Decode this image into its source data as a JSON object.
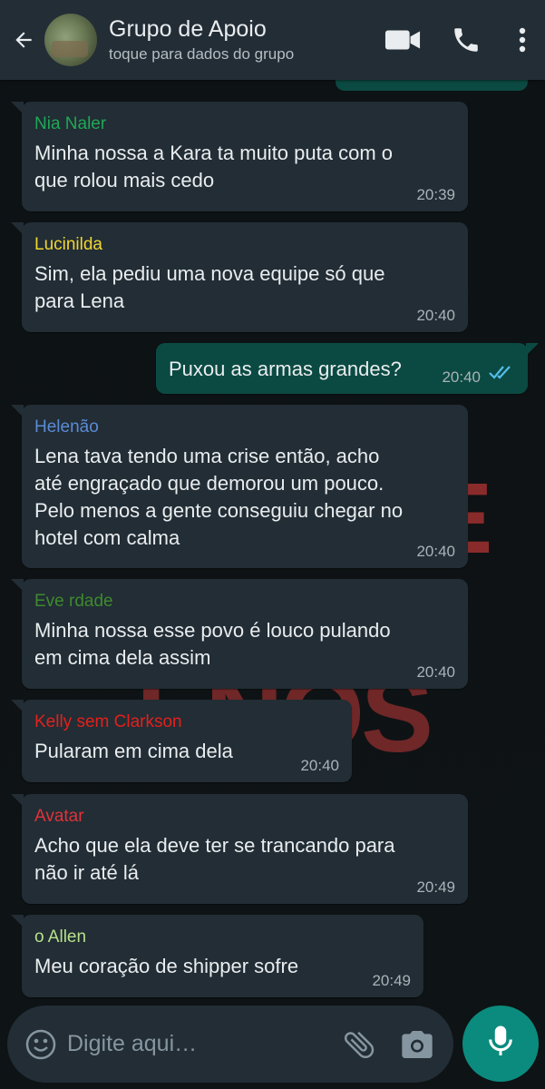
{
  "header": {
    "title": "Grupo de Apoio",
    "subtitle": "toque para dados do grupo"
  },
  "messages": [
    {
      "sender": "Nia Naler",
      "sender_color": "#1fa855",
      "text": "Minha nossa a Kara ta muito puta com o\nque rolou mais cedo",
      "time": "20:39"
    },
    {
      "sender": "Lucinilda",
      "sender_color": "#f1d631",
      "text": "Sim, ela pediu uma nova equipe só que\npara Lena",
      "time": "20:40"
    },
    {
      "text": "Puxou as armas grandes?",
      "time": "20:40",
      "status": "read"
    },
    {
      "sender": "Helenão",
      "sender_color": "#5b8bd6",
      "text": "Lena tava tendo uma crise então, acho\naté engraçado que demorou um pouco.\nPelo menos a gente conseguiu chegar no\nhotel com calma",
      "time": "20:40"
    },
    {
      "sender": "Eve rdade",
      "sender_color": "#3e8a2e",
      "text": "Minha nossa esse povo é louco pulando\nem cima dela assim",
      "time": "20:40"
    },
    {
      "sender": "Kelly sem Clarkson",
      "sender_color": "#e3201c",
      "text": "Pularam em cima dela",
      "time": "20:40"
    },
    {
      "sender": "Avatar",
      "sender_color": "#e0323a",
      "text": "Acho que ela deve ter se trancando para\nnão ir até lá",
      "time": "20:49"
    },
    {
      "sender": "o Allen",
      "sender_color": "#b8e08a",
      "text": "Meu coração de shipper sofre",
      "time": "20:49"
    }
  ],
  "input": {
    "placeholder": "Digite aqui…"
  },
  "icons": {
    "back": "arrow-left-icon",
    "video": "video-call-icon",
    "call": "phone-icon",
    "menu": "more-vert-icon",
    "emoji": "emoji-icon",
    "attach": "paperclip-icon",
    "camera": "camera-icon",
    "mic": "microphone-icon"
  },
  "colors": {
    "header_bg": "#232d36",
    "incoming_bubble": "#222d35",
    "outgoing_bubble": "#0b4a42",
    "accent": "#0b8b7d",
    "read_ticks": "#53bdeb"
  }
}
